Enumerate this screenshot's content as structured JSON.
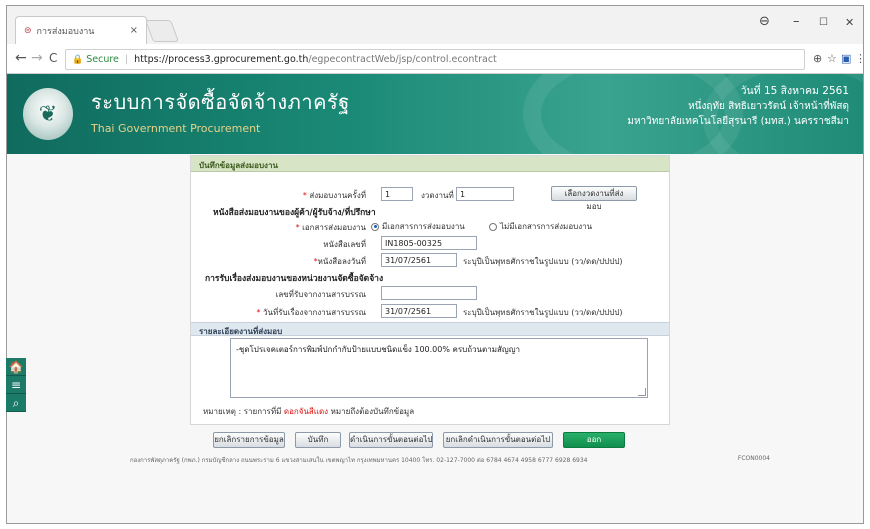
{
  "browser": {
    "tab_title": "การส่งมอบงาน",
    "tab_close": "×",
    "secure_label": "Secure",
    "url_host": "https://process3.gprocurement.go.th",
    "url_path": "/egpecontractWeb/jsp/control.econtract",
    "win_min": "–",
    "win_max": "☐",
    "win_close": "✕",
    "account_icon": "⊖"
  },
  "header": {
    "title": "ระบบการจัดซื้อจัดจ้างภาครัฐ",
    "subtitle": "Thai Government Procurement",
    "date": "วันที่ 15 สิงหาคม 2561",
    "user": "หนึ่งฤทัย สิทธิเยาวรัตน์ เจ้าหน้าที่พัสดุ",
    "org": "มหาวิทยาลัยเทคโนโลยีสุรนารี (มทส.) นครราชสีมา"
  },
  "form": {
    "panel_title": "บันทึกข้อมูลส่งมอบงาน",
    "delivery_no_label": "ส่งมอบงานครั้งที่",
    "delivery_no": "1",
    "period_label": "งวดงานที่",
    "period_no": "1",
    "select_period_btn": "เลือกงวดงานที่ส่งมอบ",
    "section1": "หนังสือส่งมอบงานของผู้ค้า/ผู้รับจ้าง/ที่ปรึกษา",
    "doc_label": "เอกสารส่งมอบงาน",
    "doc_opt1": "มีเอกสารการส่งมอบงาน",
    "doc_opt2": "ไม่มีเอกสารการส่งมอบงาน",
    "letter_no_label": "หนังสือเลขที่",
    "letter_no": "IN1805-00325",
    "letter_date_label": "หนังสือลงวันที่",
    "letter_date": "31/07/2561",
    "date_hint": "ระบุปีเป็นพุทธศักราชในรูปแบบ (วว/ดด/ปปปป)",
    "section2": "การรับเรื่องส่งมอบงานของหน่วยงานจัดซื้อจัดจ้าง",
    "receive_no_label": "เลขที่รับจากงานสารบรรณ",
    "receive_no": "",
    "receive_date_label": "วันที่รับเรื่องจากงานสารบรรณ",
    "receive_date": "31/07/2561",
    "detail_title": "รายละเอียดงานที่ส่งมอบ",
    "detail_text": "-ชุดโปรเจคเตอร์การพิมพ์ปกกำกับป้ายแบบชนิดแข็ง 100.00% ครบถ้วนตามสัญญา",
    "note_prefix": "หมายเหตุ : รายการที่มี",
    "note_red": "ดอกจันสีแดง",
    "note_suffix": "หมายถึงต้องบันทึกข้อมูล"
  },
  "buttons": {
    "cancel_data": "ยกเลิกรายการข้อมูล",
    "save": "บันทึก",
    "proceed": "ดำเนินการขั้นตอนต่อไป",
    "cancel_proceed": "ยกเลิกดำเนินการขั้นตอนต่อไป",
    "exit": "ออก"
  },
  "footer": {
    "text": "กองการพัสดุภาครัฐ (กพภ.) กรมบัญชีกลาง ถนนพระราม 6 แขวงสามเสนใน เขตพญาไท กรุงเทพมหานคร 10400 โทร. 02-127-7000 ต่อ 6784 4674 4958 6777 6928 6934",
    "code": "FCON0004"
  },
  "side": {
    "home_icon": "🏠",
    "menu_icon": "≡",
    "search_icon": "⌕"
  },
  "colors": {
    "banner": "#1a8a76",
    "panel_header": "#d7e4c6",
    "exit_button": "#108f4d",
    "required": "#dd1111"
  }
}
